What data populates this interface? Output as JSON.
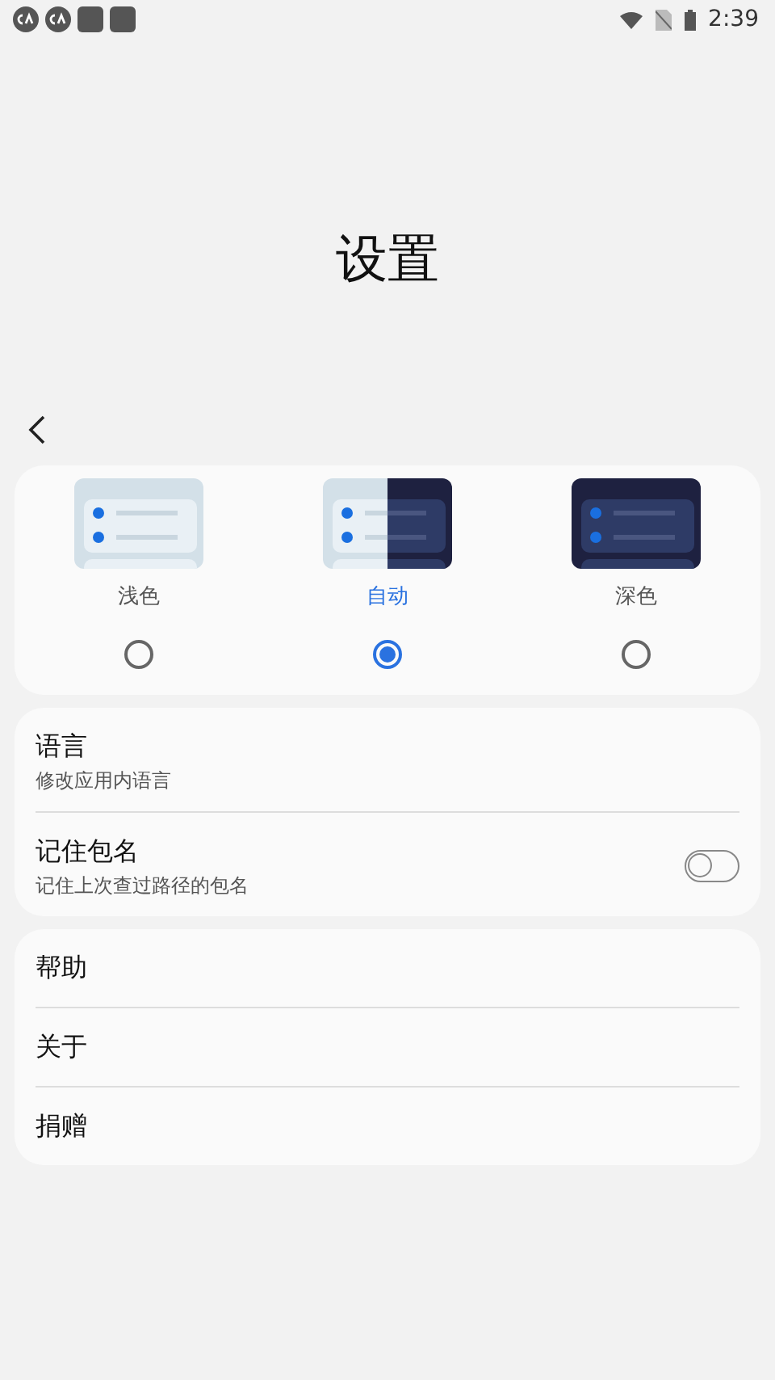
{
  "status_bar": {
    "time": "2:39"
  },
  "title": "设置",
  "themes": [
    {
      "kind": "light",
      "label": "浅色",
      "selected": false
    },
    {
      "kind": "auto",
      "label": "自动",
      "selected": true
    },
    {
      "kind": "dark",
      "label": "深色",
      "selected": false
    }
  ],
  "settings": [
    {
      "kind": "link",
      "title": "语言",
      "subtitle": "修改应用内语言"
    },
    {
      "kind": "switch",
      "title": "记住包名",
      "subtitle": "记住上次查过路径的包名",
      "on": false
    }
  ],
  "links": [
    {
      "title": "帮助"
    },
    {
      "title": "关于"
    },
    {
      "title": "捐赠"
    }
  ]
}
